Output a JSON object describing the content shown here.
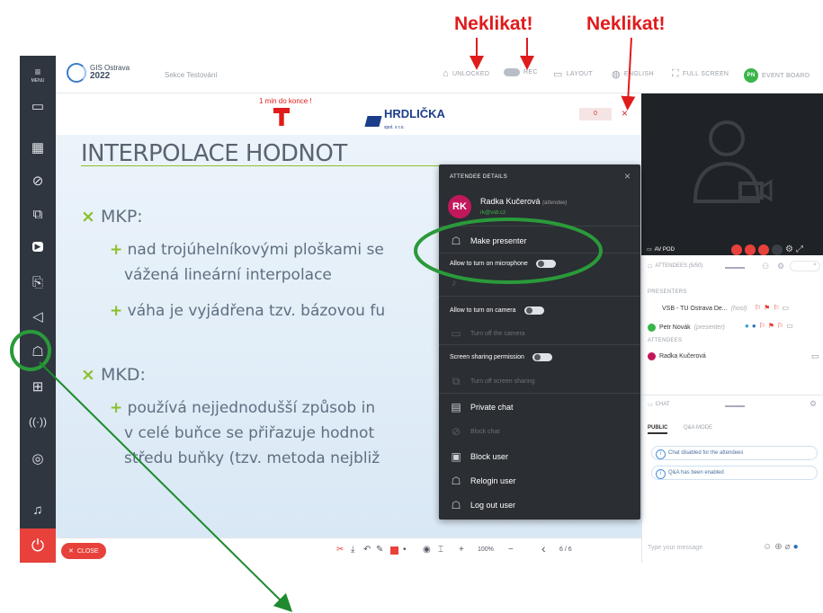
{
  "annotations": {
    "neklikat_1": "Neklikat!",
    "neklikat_2": "Neklikat!"
  },
  "rail": {
    "menu_label": "MENU",
    "icons": [
      "video-icon",
      "presentation-icon",
      "compass-icon",
      "screens-icon",
      "youtube-icon",
      "docs-icon",
      "megaphone-icon",
      "attendees-icon",
      "grid-icon",
      "broadcast-icon",
      "antenna-icon",
      "headset-icon",
      "power-icon"
    ]
  },
  "header": {
    "logo_line1": "GIS Ostrava",
    "logo_line2": "2022",
    "section": "Sekce Testování",
    "items": [
      "UNLOCKED",
      "REC",
      "LAYOUT",
      "ENGLISH",
      "FULL SCREEN",
      "EVENT BOARD"
    ]
  },
  "slide_header": {
    "timer": "1 min do konce !",
    "brand": "HRDLIČKA",
    "brand_sub": "spol. s r.o.",
    "counter": "0"
  },
  "slide": {
    "title": "INTERPOLACE HODNOT",
    "b1": "MKP:",
    "b1a_1": "nad trojúhelníkovými ploškami se",
    "b1a_2": "vážená lineární interpolace",
    "b1b": "váha je vyjádřena tzv. bázovou fu",
    "b2": "MKD:",
    "b2a_1": "používá nejjednodušší způsob in",
    "b2a_2": "v celé buňce se přiřazuje hodnot",
    "b2a_3": "středu buňky (tzv. metoda nejbliž"
  },
  "bottom": {
    "close_label": "CLOSE",
    "zoom": "100%",
    "page": "6 / 6"
  },
  "popup": {
    "title": "ATTENDEE DETAILS",
    "initials": "RK",
    "name": "Radka Kučerová",
    "role": "(attendee)",
    "email": "rk@vsb.cz",
    "make_presenter": "Make presenter",
    "allow_mic": "Allow to turn on microphone",
    "allow_cam": "Allow to turn on camera",
    "cam_dim": "Turn off the camera",
    "screen_share": "Screen sharing permission",
    "screen_dim": "Turn off screen sharing",
    "private_chat": "Private chat",
    "chat_dim": "Block chat",
    "block_user": "Block user",
    "relogin_user": "Relogin user",
    "logout_user": "Log out user",
    "toggle_off": "OFF"
  },
  "video": {
    "label": "AV POD"
  },
  "attendees": {
    "header": "ATTENDEES (5/50)",
    "presenters_label": "PRESENTERS",
    "attendees_label": "ATTENDEES",
    "p1_name": "VSB - TU Ostrava De...",
    "p1_role": "(host)",
    "p2_name": "Petr Novák",
    "p2_role": "(presenter)",
    "a1_name": "Radka Kučerová"
  },
  "chat": {
    "header": "CHAT",
    "tab_public": "PUBLIC",
    "tab_qa": "Q&A MODE",
    "info1": "Chat disabled for the attendees",
    "info2": "Q&A has been enabled",
    "placeholder": "Type your message"
  },
  "colors": {
    "annotation": "#e01b1b",
    "highlight": "#2a9a3a",
    "rail": "#2f3640",
    "popup": "#2b2e33",
    "accent_red": "#e8413b"
  }
}
